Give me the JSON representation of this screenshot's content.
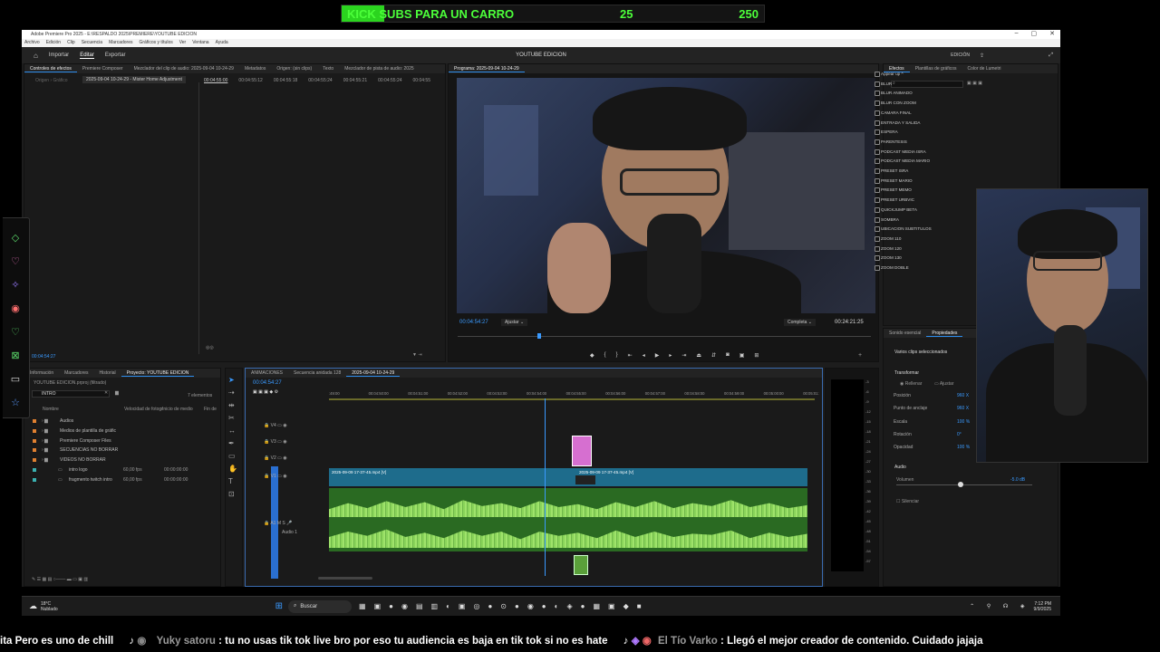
{
  "banner": {
    "goal_text": "KICK SUBS PARA UN CARRO",
    "current": "25",
    "target": "250",
    "progress": 0.1
  },
  "app": {
    "title": "Adobe Premiere Pro 2025 - E:\\RESPALDO 2025\\PREMIERE\\YOUTUBE EDICION",
    "menus": [
      "Archivo",
      "Edición",
      "Clip",
      "Secuencia",
      "Marcadores",
      "Gráficos y títulos",
      "Ver",
      "Ventana",
      "Ayuda"
    ],
    "workspace_tabs": [
      "Importar",
      "Editar",
      "Exportar"
    ],
    "workspace_name": "YOUTUBE EDICION",
    "edicion_label": "EDICIÓN"
  },
  "source_panel": {
    "tabs": [
      "Controles de efectos",
      "Premiere Composer",
      "Mezclador del clip de audio: 2025-09-04 10-24-29",
      "Metadatos",
      "Origen: (sin clips)",
      "Texto",
      "Mezclador de pista de audio: 2025"
    ],
    "master_label": "Origen › Gráfico",
    "clip_label": "2025-09-04 10-24-29 - Mister Home Adjustment",
    "times": [
      "00:04:55:00",
      "00:04:55:12",
      "00:04:55:18",
      "00:04:55:24",
      "00:04:55:21",
      "00:04:55:24",
      "00:04:55"
    ],
    "timecode": "00:04:54:27"
  },
  "program": {
    "title": "Programa: 2025-09-04 10-24-29",
    "timecode": "00:04:54:27",
    "fit": "Ajustar",
    "quality": "Completa",
    "duration": "00:24:21:25"
  },
  "effects_panel": {
    "tabs": [
      "Efectos",
      "Plantillas de gráficos",
      "Color de Lumetri"
    ],
    "items": [
      "Appear up ^",
      "BLUR",
      "BLUR ANIMADO",
      "BLUR CON ZOOM",
      "CAMARA FINAL",
      "ENTRADA Y SALIDA",
      "ESPERA",
      "PARENTESIS",
      "PODCAST MEDIA ISRA",
      "PODCAST MEDIA MARIO",
      "PRESET ISRA",
      "PRESET MARIO",
      "PRESET MEMO",
      "PRESET URBVIC",
      "QUICKJUMP BETA",
      "SOMBRA",
      "UBICACION SUBTITULOS",
      "ZOOM 110",
      "ZOOM 120",
      "ZOOM 130",
      "ZOOM DOBLE"
    ]
  },
  "properties_panel": {
    "tabs": [
      "Sonido esencial",
      "Propiedades"
    ],
    "selection": "Varios clips seleccionados",
    "transform": "Transformar",
    "fill_label": "Rellenar",
    "fit_label": "Ajustar",
    "rows": [
      {
        "label": "Posición",
        "value": "960 X"
      },
      {
        "label": "Punto de anclaje",
        "value": "960 X"
      },
      {
        "label": "Escala",
        "value": "100 %"
      },
      {
        "label": "Rotación",
        "value": "0°"
      },
      {
        "label": "Opacidad",
        "value": "100 %"
      }
    ],
    "audio": "Audio",
    "volume_label": "Volumen",
    "volume_value": "-5.0 dB",
    "mute_label": "Silenciar"
  },
  "project_panel": {
    "tabs": [
      "Información",
      "Marcadores",
      "Historial",
      "Proyecto: YOUTUBE EDICION"
    ],
    "file": "YOUTUBE EDICION.prproj (filtrado)",
    "search": "INTRO",
    "count": "7 elementos",
    "columns": [
      "Nombre",
      "Velocidad de fotogr",
      "Inicio de medio",
      "Fin de"
    ],
    "rows": [
      {
        "name": "Audios",
        "fps": "",
        "start": ""
      },
      {
        "name": "Medios de plantilla de gráfic",
        "fps": "",
        "start": ""
      },
      {
        "name": "Premiere Composer Files",
        "fps": "",
        "start": ""
      },
      {
        "name": "SECUENCIAS NO BORRAR",
        "fps": "",
        "start": ""
      },
      {
        "name": "VIDEOS NO BORRAR",
        "fps": "",
        "start": ""
      },
      {
        "name": "intro logo",
        "fps": "60,00 fps",
        "start": "00:00:00:00"
      },
      {
        "name": "fragmento twitch intro",
        "fps": "60,00 fps",
        "start": "00:00:00:00"
      }
    ]
  },
  "timeline": {
    "tabs": [
      "ANIMACIONES",
      "Secuencia anidada 128",
      "2025-09-04 10-24-29"
    ],
    "timecode": "00:04:54:27",
    "ruler": [
      ":49:00",
      "00:04:50:00",
      "00:04:51:00",
      "00:04:52:00",
      "00:04:53:00",
      "00:04:54:00",
      "00:04:55:00",
      "00:04:56:00",
      "00:04:57:00",
      "00:04:58:00",
      "00:04:59:00",
      "00:05:00:00",
      "00:05:01:"
    ],
    "tracks": [
      "V4",
      "V3",
      "V2",
      "V1",
      "A1"
    ],
    "audio_track_name": "Audio 1",
    "clip1": "2025-09-09 17-37-45.mp4 [V]",
    "clip2": "2025-09-09 17-37-45.mp4 [V]"
  },
  "meter_labels": [
    "-3",
    "-6",
    "-9",
    "-12",
    "-15",
    "-18",
    "-21",
    "-24",
    "-27",
    "-30",
    "-33",
    "-36",
    "-39",
    "-42",
    "-45",
    "-48",
    "-51",
    "-54",
    "-57"
  ],
  "taskbar": {
    "temp": "18°C",
    "weather": "Nublado",
    "search": "Buscar",
    "time": "7:12 PM",
    "date": "9/9/2025"
  },
  "chat": [
    {
      "user": "",
      "msg": "ita  Pero es uno de chill"
    },
    {
      "user": "Yuky satoru",
      "msg": "tu no usas tik tok live  bro  por eso tu audiencia es baja en tik tok  si  no es hate"
    },
    {
      "user": "El Tío Varko",
      "msg": "Llegó el mejor creador de contenido. Cuidado jajaja"
    }
  ]
}
